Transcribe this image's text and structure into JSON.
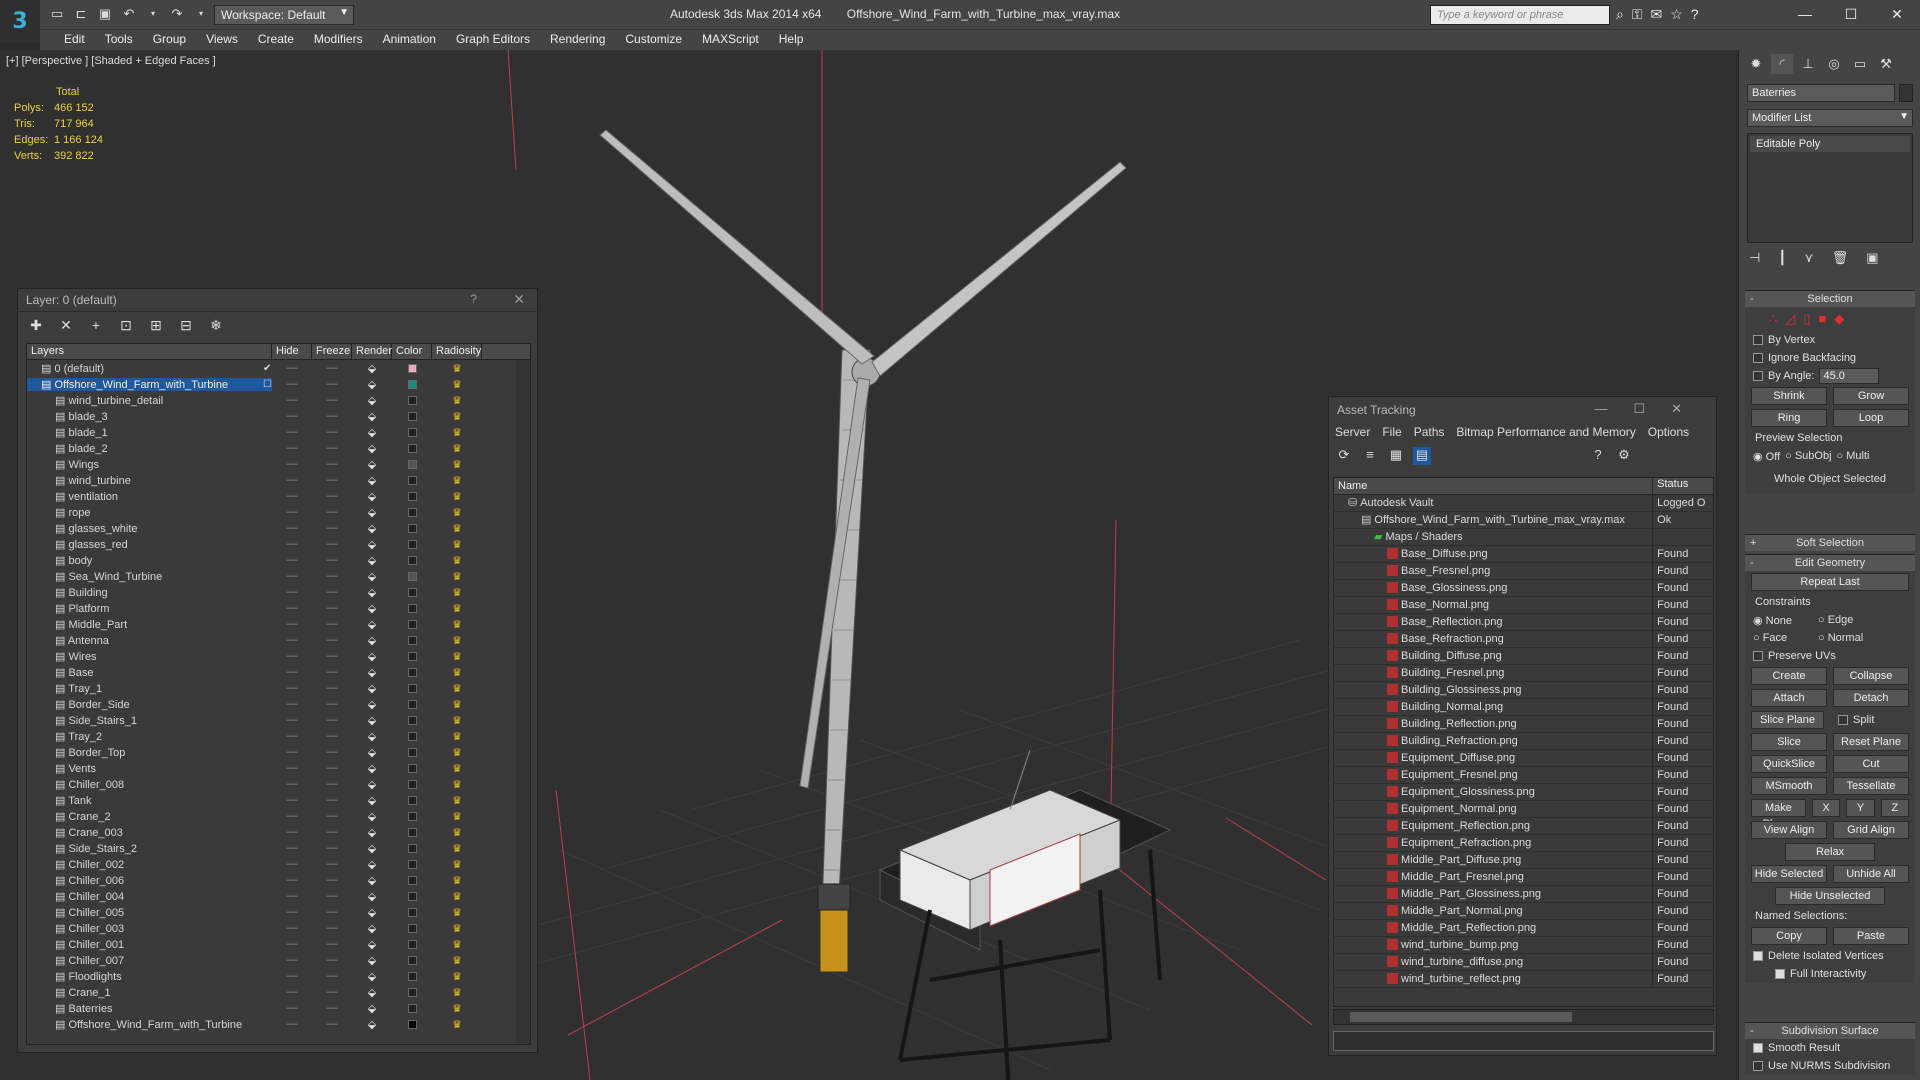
{
  "titlebar": {
    "app_title": "Autodesk 3ds Max 2014 x64",
    "file_title": "Offshore_Wind_Farm_with_Turbine_max_vray.max",
    "workspace": "Workspace: Default",
    "search_placeholder": "Type a keyword or phrase"
  },
  "menu": [
    "Edit",
    "Tools",
    "Group",
    "Views",
    "Create",
    "Modifiers",
    "Animation",
    "Graph Editors",
    "Rendering",
    "Customize",
    "MAXScript",
    "Help"
  ],
  "viewport": {
    "label": "[+] [Perspective ] [Shaded + Edged Faces ]",
    "stats_header": "Total",
    "stats": [
      {
        "label": "Polys:",
        "value": "466 152"
      },
      {
        "label": "Tris:",
        "value": "717 964"
      },
      {
        "label": "Edges:",
        "value": "1 166 124"
      },
      {
        "label": "Verts:",
        "value": "392 822"
      }
    ]
  },
  "layer_panel": {
    "title": "Layer: 0 (default)",
    "help": "?",
    "columns": [
      "Layers",
      "Hide",
      "Freeze",
      "Render",
      "Color",
      "Radiosity"
    ],
    "rows": [
      {
        "name": "0 (default)",
        "indent": 1,
        "color": "#e8a8c8",
        "selected": false,
        "check": "✔"
      },
      {
        "name": "Offshore_Wind_Farm_with_Turbine",
        "indent": 1,
        "color": "#1e8c7a",
        "selected": true,
        "check": "☐"
      },
      {
        "name": "wind_turbine_detail",
        "indent": 2,
        "color": "#222222"
      },
      {
        "name": "blade_3",
        "indent": 2,
        "color": "#222222"
      },
      {
        "name": "blade_1",
        "indent": 2,
        "color": "#222222"
      },
      {
        "name": "blade_2",
        "indent": 2,
        "color": "#222222"
      },
      {
        "name": "Wings",
        "indent": 2,
        "color": "#555555"
      },
      {
        "name": "wind_turbine",
        "indent": 2,
        "color": "#222222"
      },
      {
        "name": "ventilation",
        "indent": 2,
        "color": "#222222"
      },
      {
        "name": "rope",
        "indent": 2,
        "color": "#222222"
      },
      {
        "name": "glasses_white",
        "indent": 2,
        "color": "#222222"
      },
      {
        "name": "glasses_red",
        "indent": 2,
        "color": "#222222"
      },
      {
        "name": "body",
        "indent": 2,
        "color": "#222222"
      },
      {
        "name": "Sea_Wind_Turbine",
        "indent": 2,
        "color": "#555555"
      },
      {
        "name": "Building",
        "indent": 2,
        "color": "#222222"
      },
      {
        "name": "Platform",
        "indent": 2,
        "color": "#222222"
      },
      {
        "name": "Middle_Part",
        "indent": 2,
        "color": "#222222"
      },
      {
        "name": "Antenna",
        "indent": 2,
        "color": "#222222"
      },
      {
        "name": "Wires",
        "indent": 2,
        "color": "#222222"
      },
      {
        "name": "Base",
        "indent": 2,
        "color": "#222222"
      },
      {
        "name": "Tray_1",
        "indent": 2,
        "color": "#222222"
      },
      {
        "name": "Border_Side",
        "indent": 2,
        "color": "#222222"
      },
      {
        "name": "Side_Stairs_1",
        "indent": 2,
        "color": "#222222"
      },
      {
        "name": "Tray_2",
        "indent": 2,
        "color": "#222222"
      },
      {
        "name": "Border_Top",
        "indent": 2,
        "color": "#222222"
      },
      {
        "name": "Vents",
        "indent": 2,
        "color": "#222222"
      },
      {
        "name": "Chiller_008",
        "indent": 2,
        "color": "#222222"
      },
      {
        "name": "Tank",
        "indent": 2,
        "color": "#222222"
      },
      {
        "name": "Crane_2",
        "indent": 2,
        "color": "#222222"
      },
      {
        "name": "Crane_003",
        "indent": 2,
        "color": "#222222"
      },
      {
        "name": "Side_Stairs_2",
        "indent": 2,
        "color": "#222222"
      },
      {
        "name": "Chiller_002",
        "indent": 2,
        "color": "#222222"
      },
      {
        "name": "Chiller_006",
        "indent": 2,
        "color": "#222222"
      },
      {
        "name": "Chiller_004",
        "indent": 2,
        "color": "#222222"
      },
      {
        "name": "Chiller_005",
        "indent": 2,
        "color": "#222222"
      },
      {
        "name": "Chiller_003",
        "indent": 2,
        "color": "#222222"
      },
      {
        "name": "Chiller_001",
        "indent": 2,
        "color": "#222222"
      },
      {
        "name": "Chiller_007",
        "indent": 2,
        "color": "#222222"
      },
      {
        "name": "Floodlights",
        "indent": 2,
        "color": "#222222"
      },
      {
        "name": "Crane_1",
        "indent": 2,
        "color": "#222222"
      },
      {
        "name": "Baterries",
        "indent": 2,
        "color": "#222222"
      },
      {
        "name": "Offshore_Wind_Farm_with_Turbine",
        "indent": 2,
        "color": "#000000"
      }
    ]
  },
  "asset_panel": {
    "title": "Asset Tracking",
    "menu": [
      "Server",
      "File",
      "Paths",
      "Bitmap Performance and Memory",
      "Options"
    ],
    "columns": [
      "Name",
      "Status"
    ],
    "rows": [
      {
        "name": "Autodesk Vault",
        "status": "Logged O",
        "level": 0,
        "kind": "vault"
      },
      {
        "name": "Offshore_Wind_Farm_with_Turbine_max_vray.max",
        "status": "Ok",
        "level": 1,
        "kind": "max"
      },
      {
        "name": "Maps / Shaders",
        "status": "",
        "level": 2,
        "kind": "folder"
      },
      {
        "name": "Base_Diffuse.png",
        "status": "Found",
        "level": 3,
        "kind": "png"
      },
      {
        "name": "Base_Fresnel.png",
        "status": "Found",
        "level": 3,
        "kind": "png"
      },
      {
        "name": "Base_Glossiness.png",
        "status": "Found",
        "level": 3,
        "kind": "png"
      },
      {
        "name": "Base_Normal.png",
        "status": "Found",
        "level": 3,
        "kind": "png"
      },
      {
        "name": "Base_Reflection.png",
        "status": "Found",
        "level": 3,
        "kind": "png"
      },
      {
        "name": "Base_Refraction.png",
        "status": "Found",
        "level": 3,
        "kind": "png"
      },
      {
        "name": "Building_Diffuse.png",
        "status": "Found",
        "level": 3,
        "kind": "png"
      },
      {
        "name": "Building_Fresnel.png",
        "status": "Found",
        "level": 3,
        "kind": "png"
      },
      {
        "name": "Building_Glossiness.png",
        "status": "Found",
        "level": 3,
        "kind": "png"
      },
      {
        "name": "Building_Normal.png",
        "status": "Found",
        "level": 3,
        "kind": "png"
      },
      {
        "name": "Building_Reflection.png",
        "status": "Found",
        "level": 3,
        "kind": "png"
      },
      {
        "name": "Building_Refraction.png",
        "status": "Found",
        "level": 3,
        "kind": "png"
      },
      {
        "name": "Equipment_Diffuse.png",
        "status": "Found",
        "level": 3,
        "kind": "png"
      },
      {
        "name": "Equipment_Fresnel.png",
        "status": "Found",
        "level": 3,
        "kind": "png"
      },
      {
        "name": "Equipment_Glossiness.png",
        "status": "Found",
        "level": 3,
        "kind": "png"
      },
      {
        "name": "Equipment_Normal.png",
        "status": "Found",
        "level": 3,
        "kind": "png"
      },
      {
        "name": "Equipment_Reflection.png",
        "status": "Found",
        "level": 3,
        "kind": "png"
      },
      {
        "name": "Equipment_Refraction.png",
        "status": "Found",
        "level": 3,
        "kind": "png"
      },
      {
        "name": "Middle_Part_Diffuse.png",
        "status": "Found",
        "level": 3,
        "kind": "png"
      },
      {
        "name": "Middle_Part_Fresnel.png",
        "status": "Found",
        "level": 3,
        "kind": "png"
      },
      {
        "name": "Middle_Part_Glossiness.png",
        "status": "Found",
        "level": 3,
        "kind": "png"
      },
      {
        "name": "Middle_Part_Normal.png",
        "status": "Found",
        "level": 3,
        "kind": "png"
      },
      {
        "name": "Middle_Part_Reflection.png",
        "status": "Found",
        "level": 3,
        "kind": "png"
      },
      {
        "name": "wind_turbine_bump.png",
        "status": "Found",
        "level": 3,
        "kind": "png"
      },
      {
        "name": "wind_turbine_diffuse.png",
        "status": "Found",
        "level": 3,
        "kind": "png"
      },
      {
        "name": "wind_turbine_reflect.png",
        "status": "Found",
        "level": 3,
        "kind": "png"
      }
    ]
  },
  "command_panel": {
    "object_name": "Baterries",
    "modifier_list": "Modifier List",
    "stack": [
      "Editable Poly"
    ],
    "selection": {
      "title": "Selection",
      "by_vertex": "By Vertex",
      "ignore_backfacing": "Ignore Backfacing",
      "by_angle": "By Angle:",
      "angle_value": "45.0",
      "shrink": "Shrink",
      "grow": "Grow",
      "ring": "Ring",
      "loop": "Loop",
      "preview_title": "Preview Selection",
      "preview_off": "Off",
      "preview_subobj": "SubObj",
      "preview_multi": "Multi",
      "status": "Whole Object Selected"
    },
    "soft_selection": "Soft Selection",
    "edit_geometry": {
      "title": "Edit Geometry",
      "repeat_last": "Repeat Last",
      "constraints": "Constraints",
      "none": "None",
      "edge": "Edge",
      "face": "Face",
      "normal": "Normal",
      "preserve_uvs": "Preserve UVs",
      "create": "Create",
      "collapse": "Collapse",
      "attach": "Attach",
      "detach": "Detach",
      "slice_plane": "Slice Plane",
      "split": "Split",
      "slice": "Slice",
      "reset_plane": "Reset Plane",
      "quickslice": "QuickSlice",
      "cut": "Cut",
      "msmooth": "MSmooth",
      "tessellate": "Tessellate",
      "make_planar": "Make Planar",
      "x": "X",
      "y": "Y",
      "z": "Z",
      "view_align": "View Align",
      "grid_align": "Grid Align",
      "relax": "Relax",
      "hide_selected": "Hide Selected",
      "unhide_all": "Unhide All",
      "hide_unselected": "Hide Unselected",
      "named_selections": "Named Selections:",
      "copy": "Copy",
      "paste": "Paste",
      "delete_isolated": "Delete Isolated Vertices",
      "full_interactivity": "Full Interactivity"
    },
    "subdivision": {
      "title": "Subdivision Surface",
      "smooth_result": "Smooth Result",
      "use_nurms": "Use NURMS Subdivision"
    }
  }
}
